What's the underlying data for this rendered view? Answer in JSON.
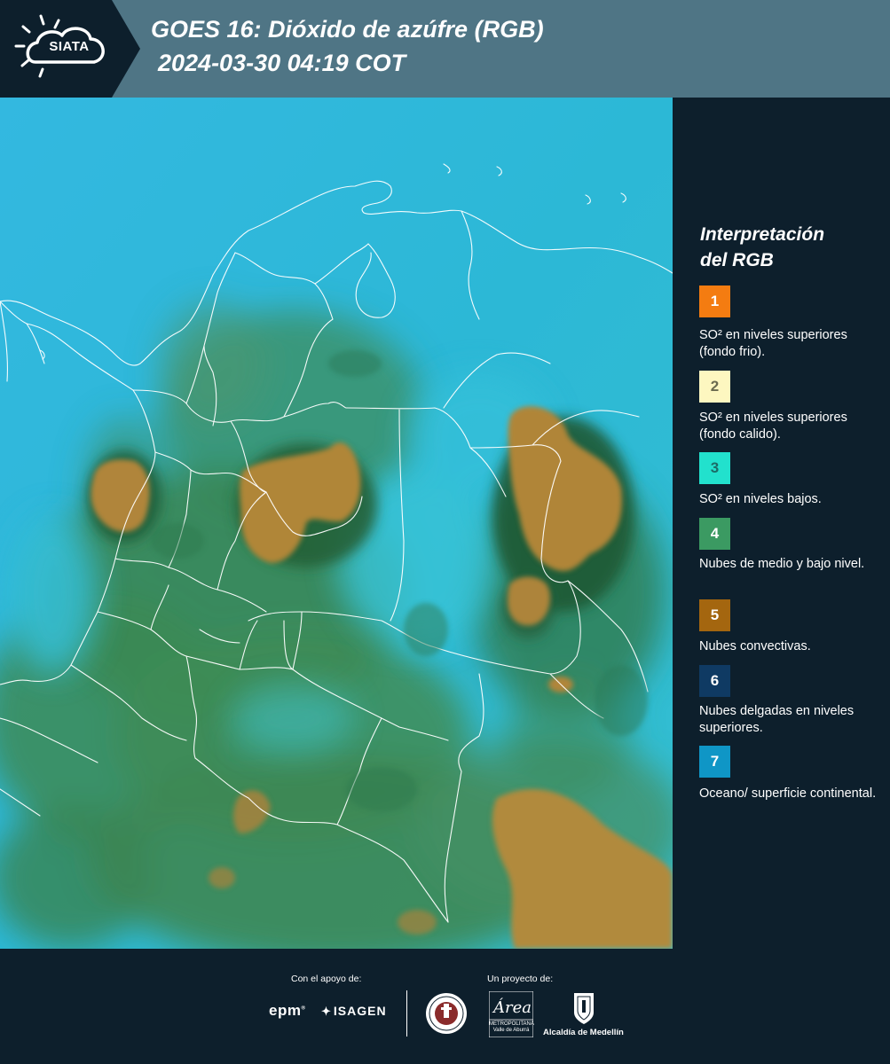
{
  "header": {
    "logo_text": "SIATA",
    "title_line1": "GOES 16: Dióxido de azúfre (RGB)",
    "title_line2": "2024-03-30 04:19 COT"
  },
  "legend": {
    "title_line1": "Interpretación",
    "title_line2": "del RGB",
    "items": [
      {
        "number": "1",
        "color": "#f47c11",
        "number_color": "#ffffff",
        "text": "SO² en niveles superiores (fondo frio)."
      },
      {
        "number": "2",
        "color": "#fdf7c0",
        "number_color": "#6b6b50",
        "text": "SO² en niveles superiores (fondo calido)."
      },
      {
        "number": "3",
        "color": "#22e1cd",
        "number_color": "#1c6b66",
        "text": "SO² en niveles bajos."
      },
      {
        "number": "4",
        "color": "#3b9a62",
        "number_color": "#ffffff",
        "text": "Nubes de medio y bajo nivel."
      },
      {
        "number": "5",
        "color": "#a4660f",
        "number_color": "#ffffff",
        "text": "Nubes convectivas."
      },
      {
        "number": "6",
        "color": "#0f3a63",
        "number_color": "#ffffff",
        "text": "Nubes delgadas en niveles superiores."
      },
      {
        "number": "7",
        "color": "#0f96c6",
        "number_color": "#ffffff",
        "text": "Oceano/ superficie continental."
      }
    ]
  },
  "footer": {
    "support_label": "Con el apoyo de:",
    "project_label": "Un proyecto de:",
    "epm": "epm",
    "isagen": "ISAGEN",
    "area_script": "Área",
    "area_line1": "METROPOLITANA",
    "area_line2": "Valle de Aburrá",
    "alcaldia": "Alcaldía de Medellín"
  },
  "colors": {
    "header_bg": "#4f7585",
    "logo_bg": "#0d1f2c",
    "page_bg": "#0d1f2c",
    "ocean_cyan": "#2bb3dc",
    "land_green": "#3e8a50",
    "convective_brown": "#a47a2c",
    "border_white": "#ffffff"
  }
}
